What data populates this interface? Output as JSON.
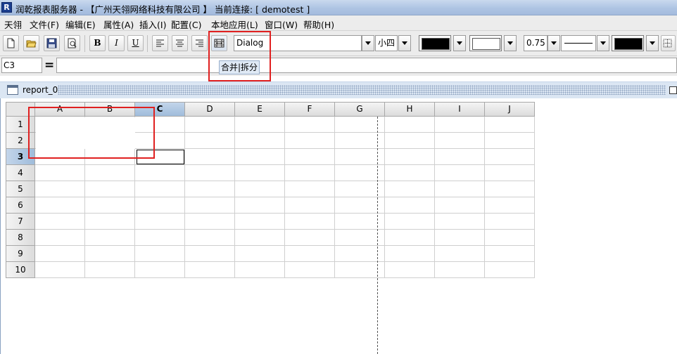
{
  "title": "润乾报表服务器 - 【广州天翎网络科技有限公司 】  当前连接: [ demotest ]",
  "menus": [
    "天翎",
    "文件(F)",
    "编辑(E)",
    "属性(A)",
    "插入(I)",
    "配置(C)",
    "本地应用(L)",
    "窗口(W)",
    "帮助(H)"
  ],
  "toolbar": {
    "font_name": "Dialog",
    "font_size": "小四",
    "border_width": "0.75",
    "fill_color": "#000000",
    "fore_color": "#ffffff",
    "tooltip": "合并|拆分"
  },
  "formula": {
    "cell_ref": "C3",
    "eq": "=",
    "value": ""
  },
  "frame": {
    "title": "report_0"
  },
  "sheet": {
    "columns": [
      "A",
      "B",
      "C",
      "D",
      "E",
      "F",
      "G",
      "H",
      "I",
      "J"
    ],
    "rows": [
      "1",
      "2",
      "3",
      "4",
      "5",
      "6",
      "7",
      "8",
      "9",
      "10"
    ],
    "selected_column": "C",
    "selected_row": "3",
    "merged_range": "A1:B2"
  }
}
